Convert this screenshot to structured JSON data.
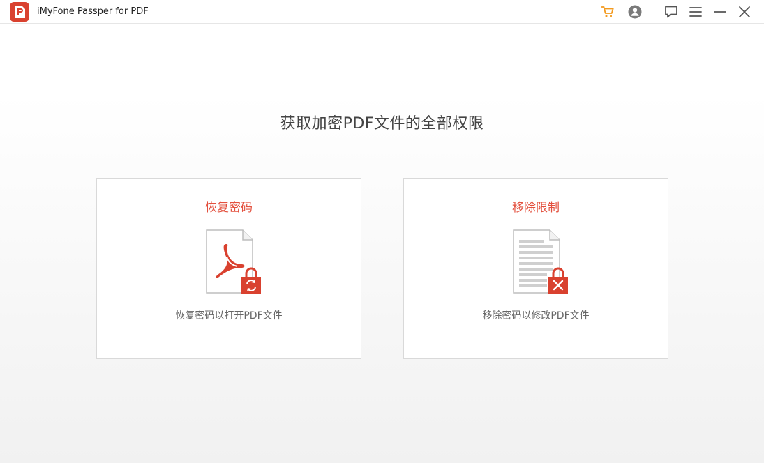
{
  "window": {
    "title": "iMyFone Passper for PDF"
  },
  "toolbar": {
    "icons": [
      "cart-icon",
      "account-icon",
      "feedback-icon",
      "menu-icon",
      "minimize-icon",
      "close-icon"
    ],
    "accent_color": "#f39a1e"
  },
  "main": {
    "headline": "获取加密PDF文件的全部权限",
    "cards": [
      {
        "title": "恢复密码",
        "description": "恢复密码以打开PDF文件",
        "icon": "pdf-lock-refresh-icon"
      },
      {
        "title": "移除限制",
        "description": "移除密码以修改PDF文件",
        "icon": "document-lock-remove-icon"
      }
    ]
  },
  "colors": {
    "brand_red": "#e3503e",
    "text_dark": "#444444",
    "text_muted": "#666666"
  }
}
